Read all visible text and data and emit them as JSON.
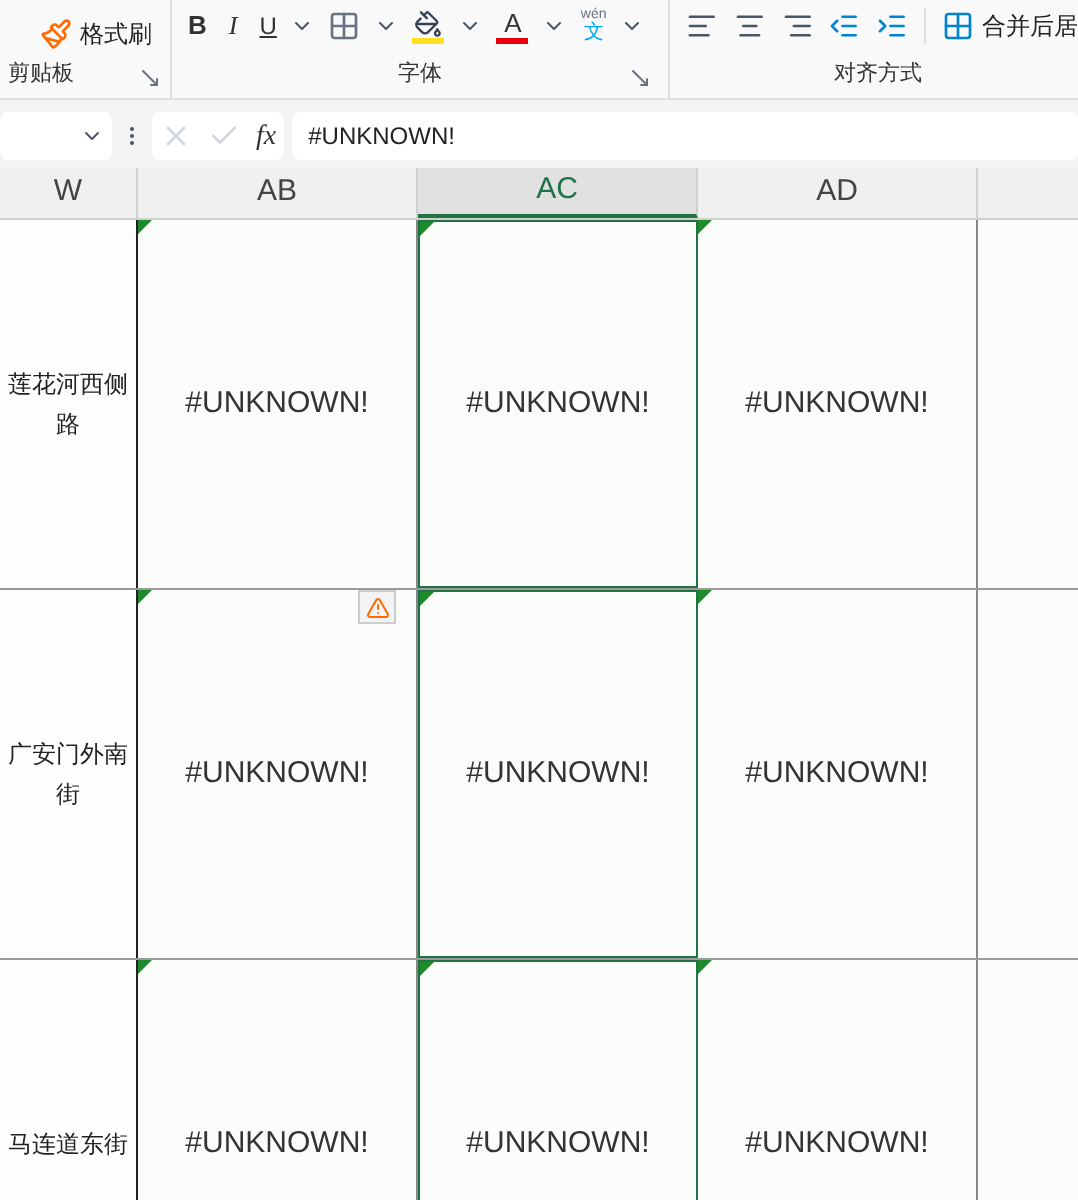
{
  "ribbon": {
    "clipboard": {
      "format_painter": "格式刷",
      "group_label": "剪贴板"
    },
    "font": {
      "bold": "B",
      "italic": "I",
      "underline": "U",
      "phonetic_top": "wén",
      "phonetic_bottom": "文",
      "font_color_letter": "A",
      "group_label": "字体"
    },
    "alignment": {
      "merge": "合并后居",
      "group_label": "对齐方式"
    }
  },
  "formula_bar": {
    "fx": "fx",
    "value": "#UNKNOWN!"
  },
  "columns": [
    {
      "label": "W",
      "selected": false
    },
    {
      "label": "AB",
      "selected": false
    },
    {
      "label": "AC",
      "selected": true
    },
    {
      "label": "AD",
      "selected": false
    }
  ],
  "rows": [
    {
      "address": "莲花河西侧路",
      "cells": [
        {
          "text": "#UNKNOWN!",
          "error_marker": true,
          "warning": false
        },
        {
          "text": "#UNKNOWN!",
          "error_marker": true,
          "warning": false
        },
        {
          "text": "#UNKNOWN!",
          "error_marker": true,
          "warning": false
        }
      ]
    },
    {
      "address": "广安门外南街",
      "cells": [
        {
          "text": "#UNKNOWN!",
          "error_marker": true,
          "warning": true
        },
        {
          "text": "#UNKNOWN!",
          "error_marker": true,
          "warning": false
        },
        {
          "text": "#UNKNOWN!",
          "error_marker": true,
          "warning": false
        }
      ]
    },
    {
      "address": "马连道东街",
      "cells": [
        {
          "text": "#UNKNOWN!",
          "error_marker": true,
          "warning": false
        },
        {
          "text": "#UNKNOWN!",
          "error_marker": true,
          "warning": false
        },
        {
          "text": "#UNKNOWN!",
          "error_marker": true,
          "warning": false
        }
      ]
    }
  ]
}
